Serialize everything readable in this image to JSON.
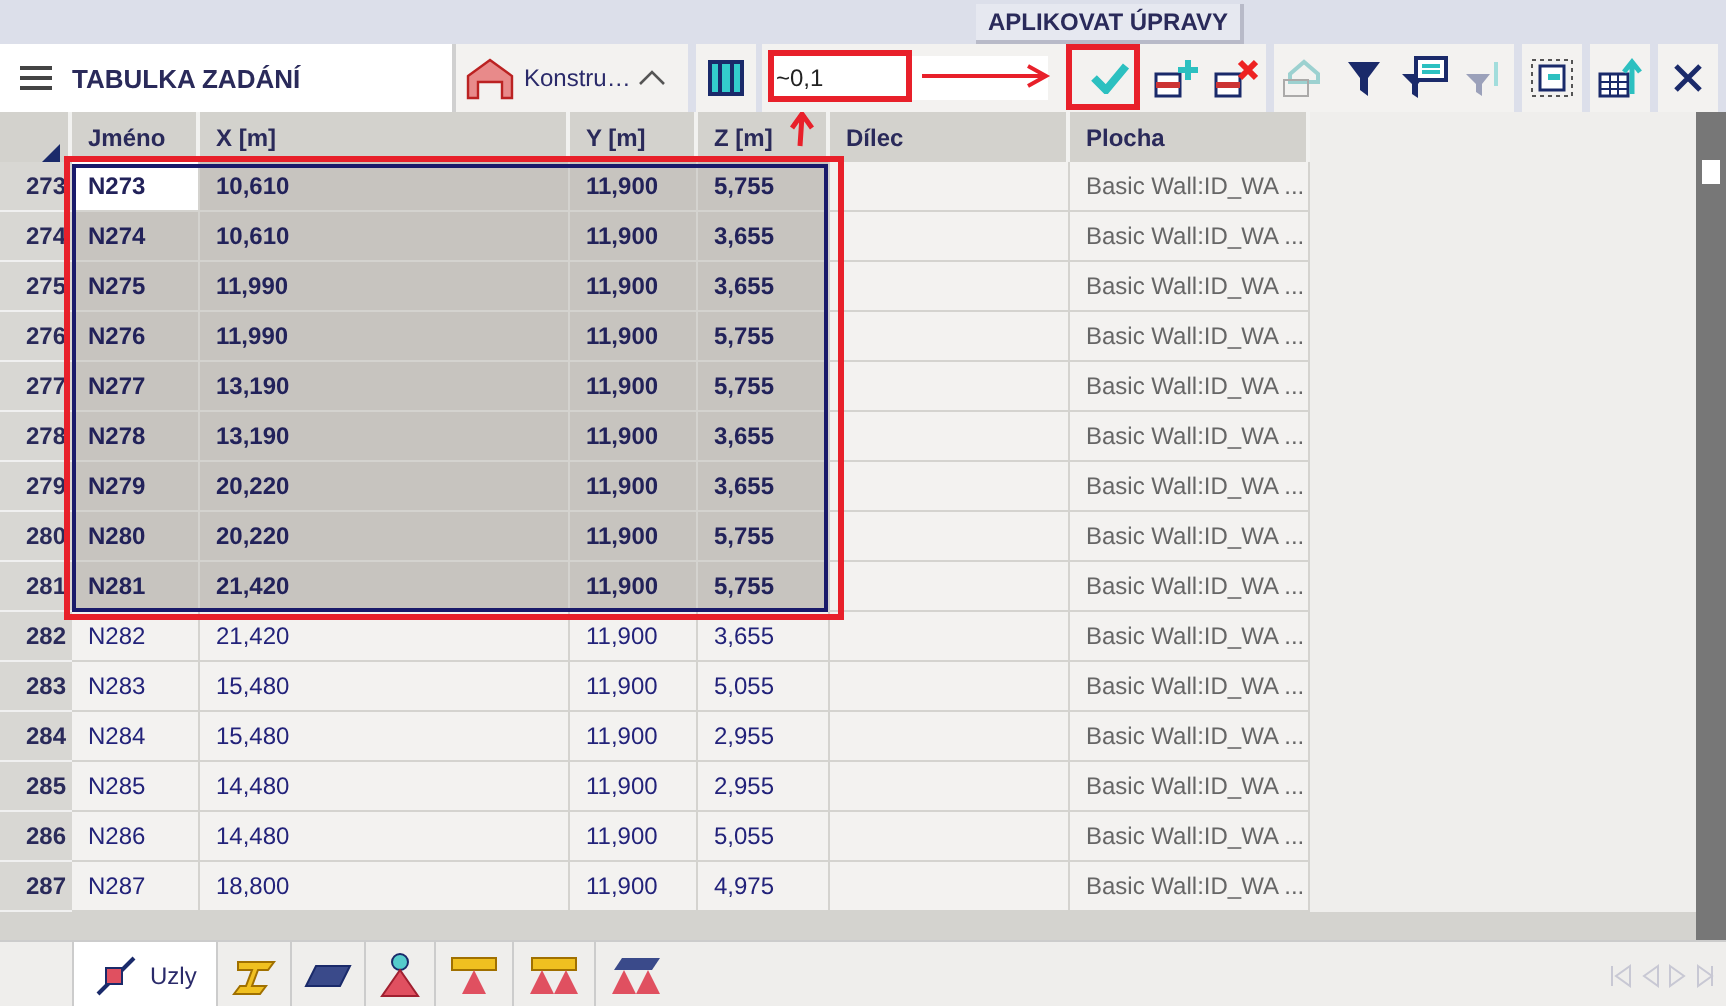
{
  "tooltip": "APLIKOVAT ÚPRAVY",
  "panel": {
    "title": "TABULKA ZADÁNÍ",
    "dropdown": "Konstru…",
    "filter_value": "~0,1"
  },
  "table": {
    "columns": [
      "Jméno",
      "X [m]",
      "Y [m]",
      "Z [m]",
      "Dílec",
      "Plocha"
    ],
    "rows": [
      {
        "number": "273",
        "cells": [
          "N273",
          "10,610",
          "11,900",
          "5,755",
          "",
          "Basic Wall:ID_WA ..."
        ],
        "selected": true,
        "focused": true
      },
      {
        "number": "274",
        "cells": [
          "N274",
          "10,610",
          "11,900",
          "3,655",
          "",
          "Basic Wall:ID_WA ..."
        ],
        "selected": true,
        "focused": false
      },
      {
        "number": "275",
        "cells": [
          "N275",
          "11,990",
          "11,900",
          "3,655",
          "",
          "Basic Wall:ID_WA ..."
        ],
        "selected": true,
        "focused": false
      },
      {
        "number": "276",
        "cells": [
          "N276",
          "11,990",
          "11,900",
          "5,755",
          "",
          "Basic Wall:ID_WA ..."
        ],
        "selected": true,
        "focused": false
      },
      {
        "number": "277",
        "cells": [
          "N277",
          "13,190",
          "11,900",
          "5,755",
          "",
          "Basic Wall:ID_WA ..."
        ],
        "selected": true,
        "focused": false
      },
      {
        "number": "278",
        "cells": [
          "N278",
          "13,190",
          "11,900",
          "3,655",
          "",
          "Basic Wall:ID_WA ..."
        ],
        "selected": true,
        "focused": false
      },
      {
        "number": "279",
        "cells": [
          "N279",
          "20,220",
          "11,900",
          "3,655",
          "",
          "Basic Wall:ID_WA ..."
        ],
        "selected": true,
        "focused": false
      },
      {
        "number": "280",
        "cells": [
          "N280",
          "20,220",
          "11,900",
          "5,755",
          "",
          "Basic Wall:ID_WA ..."
        ],
        "selected": true,
        "focused": false
      },
      {
        "number": "281",
        "cells": [
          "N281",
          "21,420",
          "11,900",
          "5,755",
          "",
          "Basic Wall:ID_WA ..."
        ],
        "selected": true,
        "focused": false
      },
      {
        "number": "282",
        "cells": [
          "N282",
          "21,420",
          "11,900",
          "3,655",
          "",
          "Basic Wall:ID_WA ..."
        ],
        "selected": false,
        "focused": false
      },
      {
        "number": "283",
        "cells": [
          "N283",
          "15,480",
          "11,900",
          "5,055",
          "",
          "Basic Wall:ID_WA ..."
        ],
        "selected": false,
        "focused": false
      },
      {
        "number": "284",
        "cells": [
          "N284",
          "15,480",
          "11,900",
          "2,955",
          "",
          "Basic Wall:ID_WA ..."
        ],
        "selected": false,
        "focused": false
      },
      {
        "number": "285",
        "cells": [
          "N285",
          "14,480",
          "11,900",
          "2,955",
          "",
          "Basic Wall:ID_WA ..."
        ],
        "selected": false,
        "focused": false
      },
      {
        "number": "286",
        "cells": [
          "N286",
          "14,480",
          "11,900",
          "5,055",
          "",
          "Basic Wall:ID_WA ..."
        ],
        "selected": false,
        "focused": false
      },
      {
        "number": "287",
        "cells": [
          "N287",
          "18,800",
          "11,900",
          "4,975",
          "",
          "Basic Wall:ID_WA ..."
        ],
        "selected": false,
        "focused": false
      }
    ]
  },
  "bottom_tabs": [
    {
      "kind": "node",
      "label": "Uzly",
      "selected": true
    },
    {
      "kind": "beam",
      "selected": false
    },
    {
      "kind": "slab",
      "selected": false
    },
    {
      "kind": "support",
      "selected": false
    },
    {
      "kind": "beamsupport",
      "selected": false
    },
    {
      "kind": "linesupport",
      "selected": false
    },
    {
      "kind": "surfacesupport",
      "selected": false
    }
  ]
}
